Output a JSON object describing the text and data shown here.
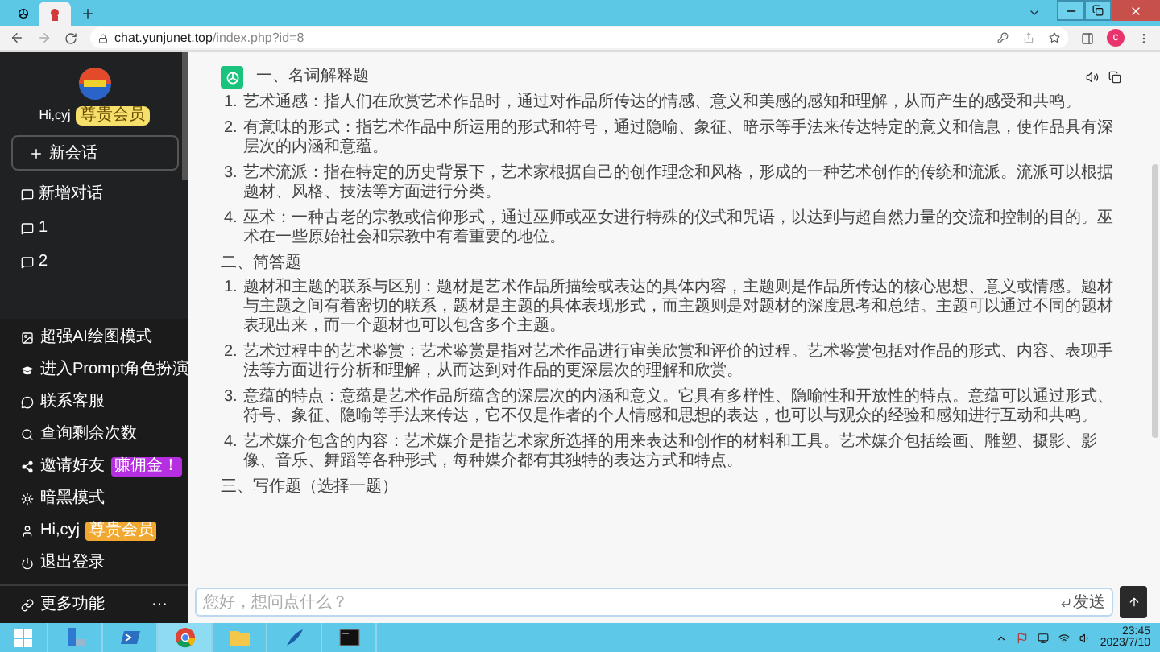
{
  "browser": {
    "tabs": [
      {
        "selected": false
      },
      {
        "selected": true
      }
    ],
    "url_host": "chat.yunjunet.top",
    "url_path": "/index.php?id=8",
    "profile_initial": "c"
  },
  "sidebar": {
    "user": {
      "greeting": "Hi,cyj",
      "badge": "尊贵会员"
    },
    "new_chat": "新会话",
    "conversations": [
      {
        "title": "新增对话"
      },
      {
        "title": "1"
      },
      {
        "title": "2"
      }
    ],
    "menu": [
      {
        "kind": "image",
        "label": "超强AI绘图模式"
      },
      {
        "kind": "cap",
        "label": "进入Prompt角色扮演"
      },
      {
        "kind": "chat",
        "label": "联系客服"
      },
      {
        "kind": "search",
        "label": "查询剩余次数"
      },
      {
        "kind": "share",
        "label": "邀请好友",
        "badge": {
          "text": "赚佣金！",
          "color": "#b52ee0"
        }
      },
      {
        "kind": "sun",
        "label": "暗黑模式"
      },
      {
        "kind": "user",
        "label": "Hi,cyj",
        "badge": {
          "text": "尊贵会员",
          "color": "#f0a830"
        }
      },
      {
        "kind": "power",
        "label": "退出登录"
      }
    ],
    "more": {
      "label": "更多功能",
      "dots": "···"
    }
  },
  "answer": {
    "sections": [
      {
        "heading": "一、名词解释题",
        "items": [
          {
            "number": "1.",
            "text": "艺术通感：指人们在欣赏艺术作品时，通过对作品所传达的情感、意义和美感的感知和理解，从而产生的感受和共鸣。"
          },
          {
            "number": "2.",
            "text": "有意味的形式：指艺术作品中所运用的形式和符号，通过隐喻、象征、暗示等手法来传达特定的意义和信息，使作品具有深层次的内涵和意蕴。"
          },
          {
            "number": "3.",
            "text": "艺术流派：指在特定的历史背景下，艺术家根据自己的创作理念和风格，形成的一种艺术创作的传统和流派。流派可以根据题材、风格、技法等方面进行分类。"
          },
          {
            "number": "4.",
            "text": "巫术：一种古老的宗教或信仰形式，通过巫师或巫女进行特殊的仪式和咒语，以达到与超自然力量的交流和控制的目的。巫术在一些原始社会和宗教中有着重要的地位。"
          }
        ]
      },
      {
        "heading": "二、简答题",
        "items": [
          {
            "number": "1.",
            "text": "题材和主题的联系与区别：题材是艺术作品所描绘或表达的具体内容，主题则是作品所传达的核心思想、意义或情感。题材与主题之间有着密切的联系，题材是主题的具体表现形式，而主题则是对题材的深度思考和总结。主题可以通过不同的题材表现出来，而一个题材也可以包含多个主题。"
          },
          {
            "number": "2.",
            "text": "艺术过程中的艺术鉴赏：艺术鉴赏是指对艺术作品进行审美欣赏和评价的过程。艺术鉴赏包括对作品的形式、内容、表现手法等方面进行分析和理解，从而达到对作品的更深层次的理解和欣赏。"
          },
          {
            "number": "3.",
            "text": "意蕴的特点：意蕴是艺术作品所蕴含的深层次的内涵和意义。它具有多样性、隐喻性和开放性的特点。意蕴可以通过形式、符号、象征、隐喻等手法来传达，它不仅是作者的个人情感和思想的表达，也可以与观众的经验和感知进行互动和共鸣。"
          },
          {
            "number": "4.",
            "text": "艺术媒介包含的内容：艺术媒介是指艺术家所选择的用来表达和创作的材料和工具。艺术媒介包括绘画、雕塑、摄影、影像、音乐、舞蹈等各种形式，每种媒介都有其独特的表达方式和特点。"
          }
        ]
      },
      {
        "heading": "三、写作题（选择一题）"
      }
    ]
  },
  "input": {
    "placeholder": "您好，想问点什么？",
    "send": "发送"
  },
  "taskbar": {
    "apps": [
      {
        "kind": "server",
        "selected": false
      },
      {
        "kind": "shell",
        "selected": false
      },
      {
        "kind": "chrome",
        "selected": true
      },
      {
        "kind": "folder",
        "selected": false
      },
      {
        "kind": "tool",
        "selected": false
      },
      {
        "kind": "cmd",
        "selected": false
      }
    ],
    "time": "23:45",
    "date": "2023/7/10"
  }
}
